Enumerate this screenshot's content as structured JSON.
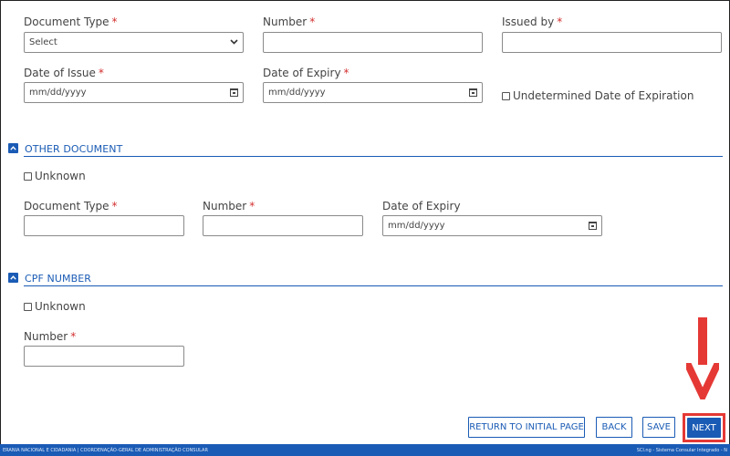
{
  "identity_doc": {
    "doc_type_label": "Document Type",
    "doc_type_value": "Select",
    "number_label": "Number",
    "issued_by_label": "Issued by",
    "date_issue_label": "Date of Issue",
    "date_issue_placeholder": "mm/dd/yyyy",
    "date_expiry_label": "Date of Expiry",
    "date_expiry_placeholder": "mm/dd/yyyy",
    "undetermined_label": "Undetermined Date of Expiration",
    "required_mark": "*"
  },
  "other_document": {
    "title": "OTHER DOCUMENT",
    "unknown_label": "Unknown",
    "doc_type_label": "Document Type",
    "number_label": "Number",
    "date_expiry_label": "Date of Expiry",
    "date_expiry_placeholder": "mm/dd/yyyy"
  },
  "cpf": {
    "title": "CPF NUMBER",
    "unknown_label": "Unknown",
    "number_label": "Number"
  },
  "actions": {
    "return_label": "RETURN TO INITIAL PAGE",
    "back_label": "BACK",
    "save_label": "SAVE",
    "next_label": "NEXT"
  },
  "footer": {
    "left_text": "ERANIA NACIONAL E CIDADANIA | COORDENAÇÃO-GERAL DE ADMINISTRAÇÃO CONSULAR",
    "right_text": "SCI.ng - Sistema Consular Integrado - N"
  },
  "colors": {
    "accent": "#1a5bb5",
    "required": "#d32f2f",
    "annotation": "#e53935"
  },
  "icons": [
    "calendar-icon",
    "chevron-down-icon",
    "chevron-up-icon",
    "down-arrow-annotation"
  ]
}
